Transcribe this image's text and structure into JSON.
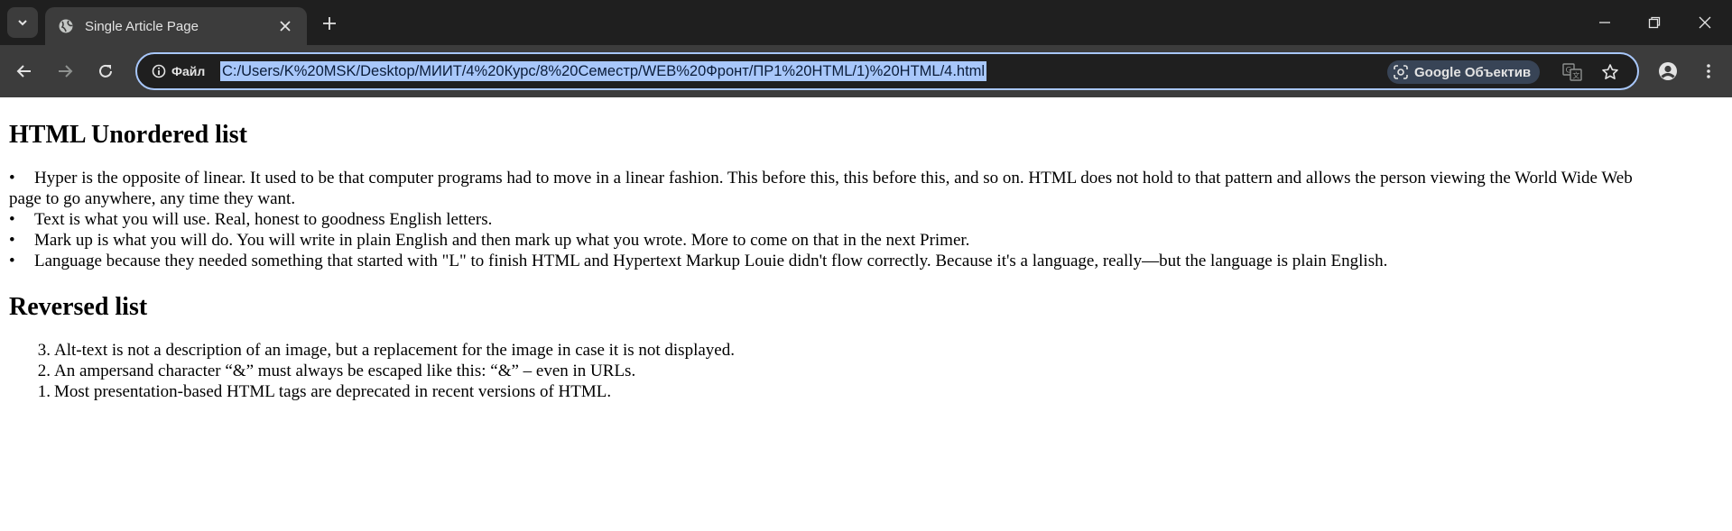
{
  "browser": {
    "tab_title": "Single Article Page",
    "site_info_label": "Файл",
    "url": "C:/Users/K%20MSK/Desktop/МИИТ/4%20Курс/8%20Семестр/WEB%20Фронт/ПР1%20HTML/1)%20HTML/4.html",
    "lens_label": "Google Объектив",
    "accent_color": "#a8c7fa"
  },
  "article": {
    "heading_unordered": "HTML Unordered list",
    "unordered_items": [
      {
        "bullet": "•",
        "first_line": "Hyper is the opposite of linear. It used to be that computer programs had to move in a linear fashion. This before this, this before this, and so on. HTML does not hold to that pattern and allows the person viewing the World Wide Web",
        "continuation": "page to go anywhere, any time they want."
      },
      {
        "bullet": "•",
        "text": "Text is what you will use. Real, honest to goodness English letters."
      },
      {
        "bullet": "•",
        "text": "Mark up is what you will do. You will write in plain English and then mark up what you wrote. More to come on that in the next Primer."
      },
      {
        "bullet": "•",
        "text": "Language because they needed something that started with \"L\" to finish HTML and Hypertext Markup Louie didn't flow correctly. Because it's a language, really—but the language is plain English."
      }
    ],
    "heading_reversed": "Reversed list",
    "reversed_items": [
      {
        "number": "3.",
        "text": "Alt-text is not a description of an image, but a replacement for the image in case it is not displayed."
      },
      {
        "number": "2.",
        "text": "An ampersand character “&” must always be escaped like this: “&” – even in URLs."
      },
      {
        "number": "1.",
        "text": "Most presentation-based HTML tags are deprecated in recent versions of HTML."
      }
    ]
  }
}
